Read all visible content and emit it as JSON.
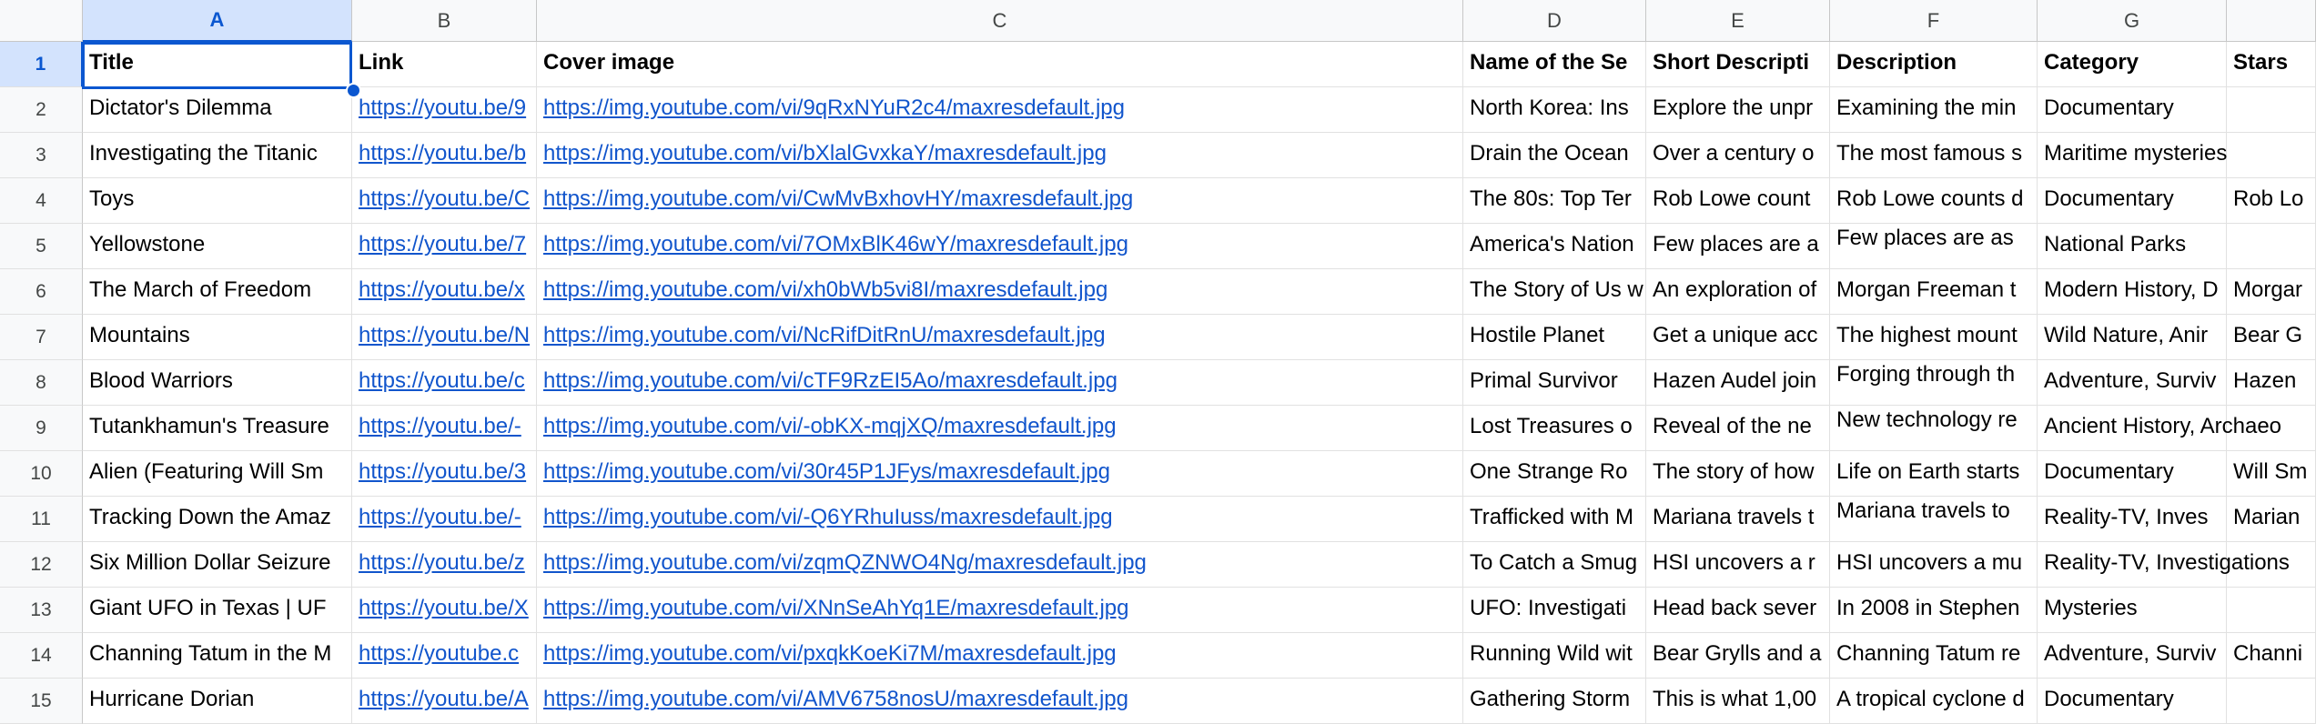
{
  "column_letters": [
    "A",
    "B",
    "C",
    "D",
    "E",
    "F",
    "G",
    ""
  ],
  "row_numbers": [
    "1",
    "2",
    "3",
    "4",
    "5",
    "6",
    "7",
    "8",
    "9",
    "10",
    "11",
    "12",
    "13",
    "14",
    "15"
  ],
  "selected_cell": "A1",
  "rows": [
    [
      "Title",
      "Link",
      "Cover image",
      "Name of the Se",
      "Short Descripti",
      "Description",
      "Category",
      "Stars"
    ],
    [
      "Dictator's Dilemma",
      "https://youtu.be/9",
      "https://img.youtube.com/vi/9qRxNYuR2c4/maxresdefault.jpg",
      "North Korea: Ins",
      "Explore the unpr",
      "Examining the min",
      "Documentary",
      ""
    ],
    [
      "Investigating the Titanic",
      "https://youtu.be/b",
      "https://img.youtube.com/vi/bXlalGvxkaY/maxresdefault.jpg",
      "Drain the Ocean",
      "Over a century o",
      "The most famous s",
      "Maritime mysteries",
      ""
    ],
    [
      "Toys",
      "https://youtu.be/C",
      "https://img.youtube.com/vi/CwMvBxhovHY/maxresdefault.jpg",
      "The 80s: Top Ter",
      "Rob Lowe count",
      "Rob Lowe counts d",
      "Documentary",
      "Rob Lo"
    ],
    [
      "Yellowstone",
      "https://youtu.be/7",
      "https://img.youtube.com/vi/7OMxBlK46wY/maxresdefault.jpg",
      "America's Nation",
      "Few places are a",
      "Few places are as",
      "National Parks",
      ""
    ],
    [
      "The March of Freedom",
      "https://youtu.be/x",
      "https://img.youtube.com/vi/xh0bWb5vi8I/maxresdefault.jpg",
      "The Story of Us w",
      "An exploration of",
      "Morgan Freeman t",
      "Modern History, D",
      "Morgar"
    ],
    [
      "Mountains",
      "https://youtu.be/N",
      "https://img.youtube.com/vi/NcRifDitRnU/maxresdefault.jpg",
      "Hostile Planet",
      "Get a unique acc",
      "The highest mount",
      "Wild Nature, Anir",
      "Bear G"
    ],
    [
      "Blood Warriors",
      "https://youtu.be/c",
      "https://img.youtube.com/vi/cTF9RzEI5Ao/maxresdefault.jpg",
      "Primal Survivor",
      "Hazen Audel join",
      "Forging through th",
      "Adventure, Surviv",
      "Hazen"
    ],
    [
      "Tutankhamun's Treasure",
      "https://youtu.be/-",
      "https://img.youtube.com/vi/-obKX-mqjXQ/maxresdefault.jpg",
      "Lost Treasures o",
      "Reveal of the ne",
      "New technology re",
      "Ancient History, Archaeo",
      ""
    ],
    [
      "Alien (Featuring Will Sm",
      "https://youtu.be/3",
      "https://img.youtube.com/vi/30r45P1JFys/maxresdefault.jpg",
      "One Strange Ro",
      "The story of how",
      "Life on Earth starts",
      "Documentary",
      "Will Sm"
    ],
    [
      "Tracking Down the Amaz",
      "https://youtu.be/-",
      "https://img.youtube.com/vi/-Q6YRhuIuss/maxresdefault.jpg",
      "Trafficked with M",
      "Mariana travels t",
      "Mariana travels to",
      "Reality-TV, Inves",
      "Marian"
    ],
    [
      "Six Million Dollar Seizure",
      "https://youtu.be/z",
      "https://img.youtube.com/vi/zqmQZNWO4Ng/maxresdefault.jpg",
      "To Catch a Smug",
      "HSI uncovers a r",
      "HSI uncovers a mu",
      "Reality-TV, Investigations",
      ""
    ],
    [
      "Giant UFO in Texas | UF",
      "https://youtu.be/X",
      "https://img.youtube.com/vi/XNnSeAhYq1E/maxresdefault.jpg",
      "UFO: Investigati",
      "Head back sever",
      "In 2008 in Stephen",
      "Mysteries",
      ""
    ],
    [
      "Channing Tatum in the M",
      "https://youtube.c",
      "https://img.youtube.com/vi/pxqkKoeKi7M/maxresdefault.jpg",
      "Running Wild wit",
      "Bear Grylls and a",
      "Channing Tatum re",
      "Adventure, Surviv",
      "Channi"
    ],
    [
      "Hurricane Dorian",
      "https://youtu.be/A",
      "https://img.youtube.com/vi/AMV6758nosU/maxresdefault.jpg",
      "Gathering Storm",
      "This is what 1,00",
      "A tropical cyclone d",
      "Documentary",
      ""
    ]
  ]
}
